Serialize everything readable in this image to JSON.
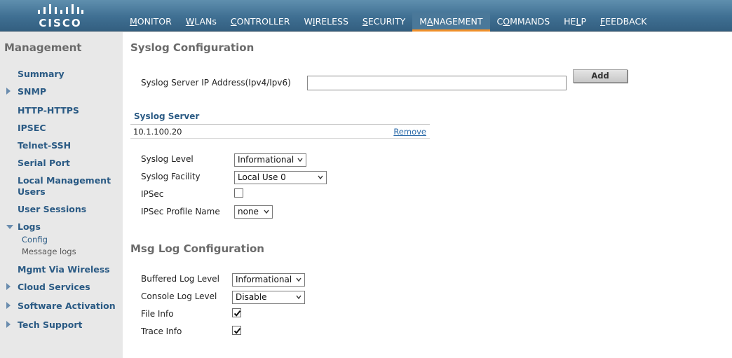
{
  "brand": {
    "logo_text": "CISCO"
  },
  "nav": {
    "items": [
      {
        "pre": "",
        "ul": "M",
        "post": "ONITOR",
        "active": false
      },
      {
        "pre": "",
        "ul": "W",
        "post": "LANs",
        "active": false
      },
      {
        "pre": "",
        "ul": "C",
        "post": "ONTROLLER",
        "active": false
      },
      {
        "pre": "W",
        "ul": "I",
        "post": "RELESS",
        "active": false
      },
      {
        "pre": "",
        "ul": "S",
        "post": "ECURITY",
        "active": false
      },
      {
        "pre": "M",
        "ul": "A",
        "post": "NAGEMENT",
        "active": true
      },
      {
        "pre": "C",
        "ul": "O",
        "post": "MMANDS",
        "active": false
      },
      {
        "pre": "HE",
        "ul": "L",
        "post": "P",
        "active": false
      },
      {
        "pre": "",
        "ul": "F",
        "post": "EEDBACK",
        "active": false
      }
    ]
  },
  "sidebar": {
    "title": "Management",
    "items": [
      {
        "label": "Summary"
      },
      {
        "label": "SNMP"
      },
      {
        "label": "HTTP-HTTPS"
      },
      {
        "label": "IPSEC"
      },
      {
        "label": "Telnet-SSH"
      },
      {
        "label": "Serial Port"
      },
      {
        "label": "Local Management Users"
      },
      {
        "label": "User Sessions"
      },
      {
        "label": "Logs"
      },
      {
        "label": "Mgmt Via Wireless"
      },
      {
        "label": "Cloud Services"
      },
      {
        "label": "Software Activation"
      },
      {
        "label": "Tech Support"
      }
    ],
    "subitems": [
      {
        "label": "Config"
      },
      {
        "label": "Message logs"
      }
    ]
  },
  "syslog": {
    "title": "Syslog Configuration",
    "server_ip_label": "Syslog Server IP Address(Ipv4/Ipv6)",
    "server_ip_value": "",
    "add_label": "Add",
    "table_header": "Syslog Server",
    "servers": [
      {
        "ip": "10.1.100.20",
        "action": "Remove"
      }
    ],
    "level_label": "Syslog Level",
    "level_value": "Informational",
    "facility_label": "Syslog Facility",
    "facility_value": "Local Use 0",
    "ipsec_label": "IPSec",
    "ipsec_checked": false,
    "ipsec_profile_label": "IPSec Profile Name",
    "ipsec_profile_value": "none"
  },
  "msglog": {
    "title": "Msg Log Configuration",
    "buffered_label": "Buffered Log Level",
    "buffered_value": "Informational",
    "console_label": "Console Log Level",
    "console_value": "Disable",
    "fileinfo_label": "File Info",
    "fileinfo_checked": true,
    "traceinfo_label": "Trace Info",
    "traceinfo_checked": true
  },
  "colors": {
    "topbar": "#3f6f92",
    "active_tab_underline": "#f0902a",
    "sidebar_bg": "#e8e8e8",
    "sidebar_link": "#2a5a84",
    "heading_gray": "#6a6a6a",
    "link_blue": "#2b6aa8"
  }
}
